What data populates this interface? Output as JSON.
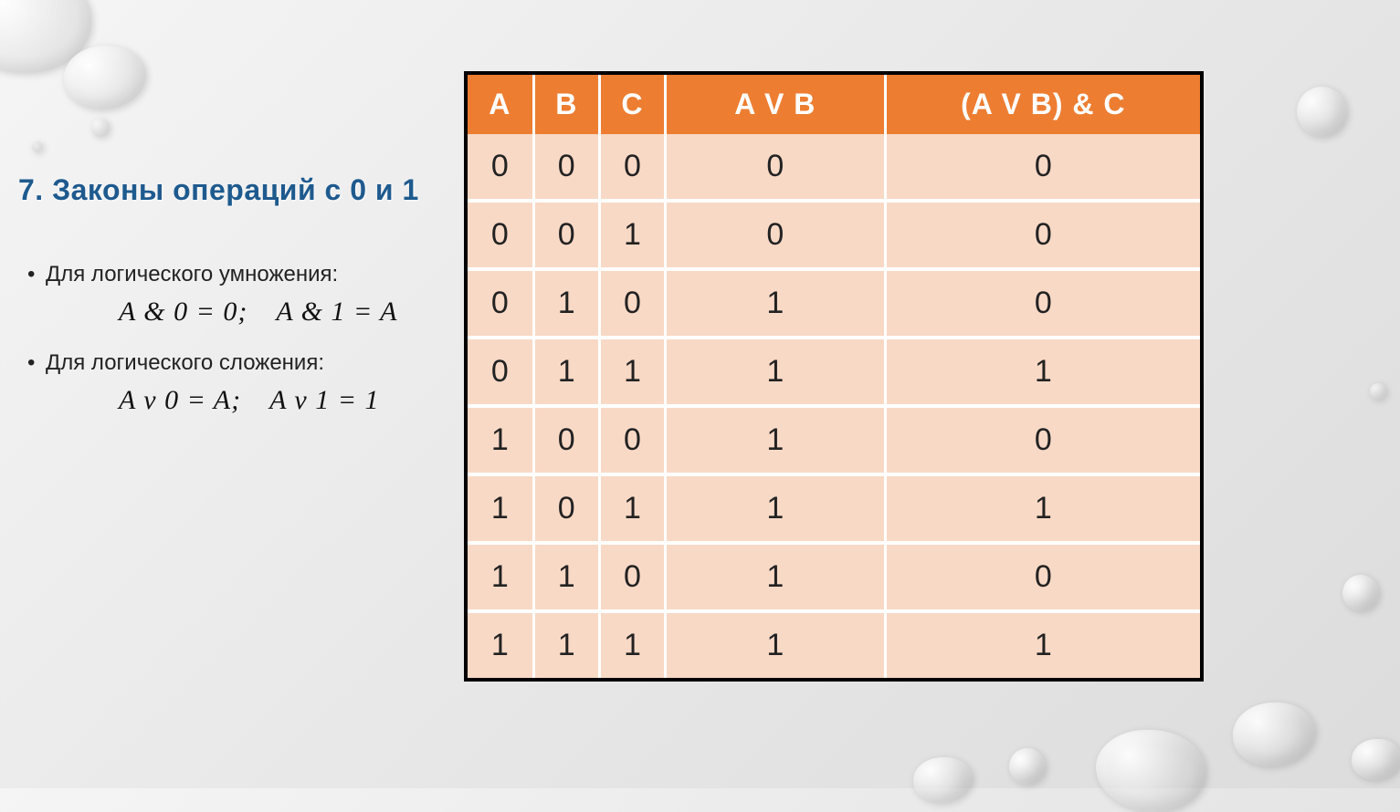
{
  "heading": "7. Законы операций с 0 и 1",
  "bullets": {
    "mul_label": "Для логического умножения:",
    "mul_formula": "A & 0 = 0; A & 1 = A",
    "add_label": "Для логического сложения:",
    "add_formula": "A v 0 = A; A v 1 = 1"
  },
  "chart_data": {
    "type": "table",
    "columns": [
      "A",
      "B",
      "C",
      "A V B",
      "(A V B) & C"
    ],
    "rows": [
      [
        "0",
        "0",
        "0",
        "0",
        "0"
      ],
      [
        "0",
        "0",
        "1",
        "0",
        "0"
      ],
      [
        "0",
        "1",
        "0",
        "1",
        "0"
      ],
      [
        "0",
        "1",
        "1",
        "1",
        "1"
      ],
      [
        "1",
        "0",
        "0",
        "1",
        "0"
      ],
      [
        "1",
        "0",
        "1",
        "1",
        "1"
      ],
      [
        "1",
        "1",
        "0",
        "1",
        "0"
      ],
      [
        "1",
        "1",
        "1",
        "1",
        "1"
      ]
    ]
  }
}
